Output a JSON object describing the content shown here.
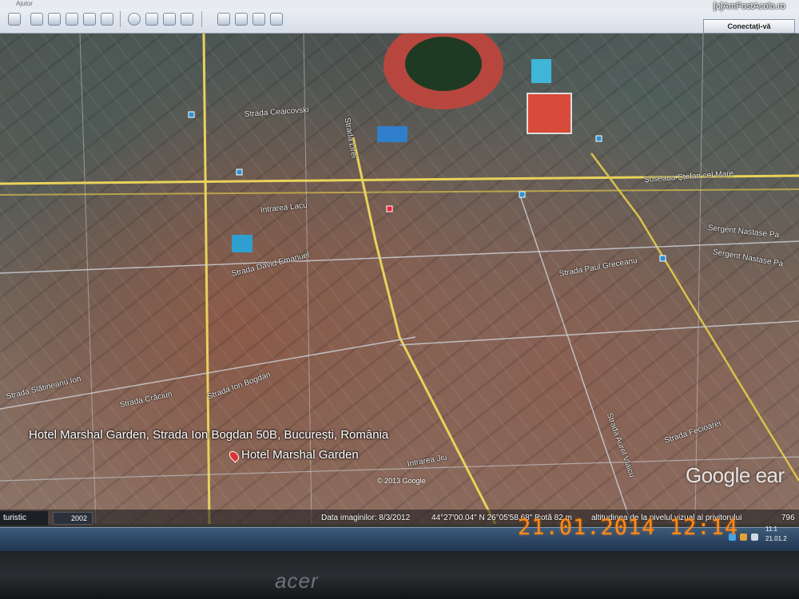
{
  "app": {
    "window_title": "Ajutor",
    "connect_button": "Conectați-vă",
    "watermark": "[c]AmFostAcolo.ro"
  },
  "map": {
    "streets": [
      "Intrarea Lacu",
      "Strada David Emanuel",
      "Strada Ion Bogdan",
      "Strada Slătineanu Ion",
      "Strada Crăciun",
      "Strada Paul Greceanu",
      "Strada Aurel Vlaicu",
      "Strada Fecioarei",
      "Intrarea Jiu",
      "Sergent Nastase Pa",
      "Sergent Nastase Pa",
      "Șoseaua Ștefan cel Mare",
      "Strada Ceaicovski",
      "Strada Lirei"
    ],
    "place_title": "Hotel Marshal Garden, Strada Ion Bogdan 50B, București, România",
    "place_name": "Hotel Marshal Garden",
    "copyright": "© 2013 Google",
    "logo": "Google ear"
  },
  "status": {
    "layer": "turistic",
    "year": "2002",
    "imagery_date": "Data imaginilor: 8/3/2012",
    "coordinates": "44°27'00.04\" N  26°05'58.68\" E",
    "elevation": "cotă  82 m",
    "eye_altitude": "altitudinea de la nivelul vizual al privitorului",
    "altitude_value": "796"
  },
  "taskbar": {
    "clock_time": "11:1",
    "clock_date": "21.01.2"
  },
  "camera": {
    "datestamp": "21.01.2014 12:14"
  },
  "monitor": {
    "brand": "acer"
  },
  "colors": {
    "datestamp": "#ff8a1a",
    "road": "#e8d25a",
    "toolbar": "#dce3ec"
  }
}
